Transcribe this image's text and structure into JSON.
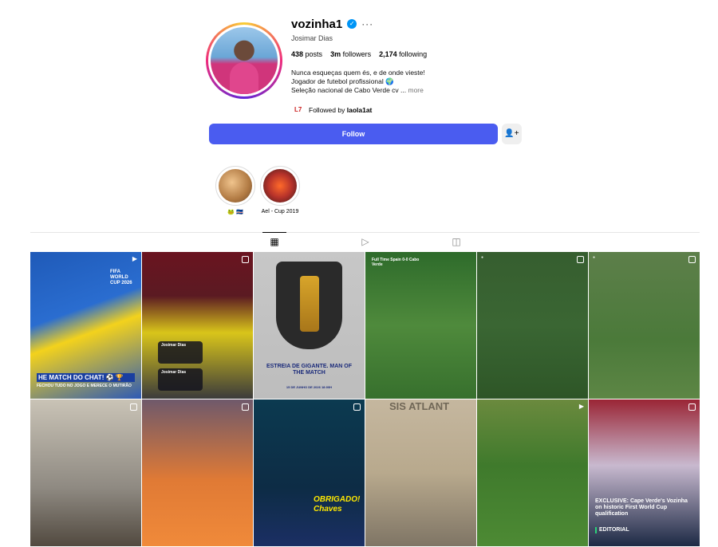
{
  "profile": {
    "username": "vozinha1",
    "fullname": "Josimar Dias",
    "stats": {
      "posts_count": "438",
      "posts_label": "posts",
      "followers_count": "3m",
      "followers_label": "followers",
      "following_count": "2,174",
      "following_label": "following"
    },
    "bio": [
      "Nunca esqueças quem és, e de onde vieste!",
      "Jogador de futebol profissional 🌍",
      "Seleção nacional de Cabo Verde cv ..."
    ],
    "bio_more": "more",
    "followed_by_prefix": "Followed by",
    "followed_by_user": "laola1at",
    "followed_logo": "L7"
  },
  "actions": {
    "follow_label": "Follow",
    "suggest_icon": "add-user-icon"
  },
  "highlights": [
    {
      "label": "🐸 🇨🇻"
    },
    {
      "label": "Ael - Cup 2019"
    }
  ],
  "tabs": [
    "grid-icon",
    "reels-icon",
    "tagged-icon"
  ],
  "posts": [
    {
      "text": "HE MATCH DO CHAT! ⚽ 🏆",
      "subtext": "FECHOU TUDO NO JOGO E MERECE O MUTIRÃO",
      "badge": "FIFA WORLD CUP 2026"
    },
    {
      "text": "",
      "card1": "Josimar Dias",
      "card2": "Josimar Dias"
    },
    {
      "text": "ESTREIA DE GIGANTE. MAN OF THE MATCH",
      "subtext": "15 DE JUNHO DE 2026 18:00H"
    },
    {
      "text": "Full Time Spain 0-0 Cabo Verde"
    },
    {
      "text": ""
    },
    {
      "text": ""
    },
    {
      "text": ""
    },
    {
      "text": ""
    },
    {
      "text": "OBRIGADO! Chaves"
    },
    {
      "text": "SIS ATLANT"
    },
    {
      "text": ""
    },
    {
      "text": "EXCLUSIVE: Cape Verde's Vozinha on historic First World Cup qualification",
      "subtext": "EDITORIAL"
    }
  ]
}
